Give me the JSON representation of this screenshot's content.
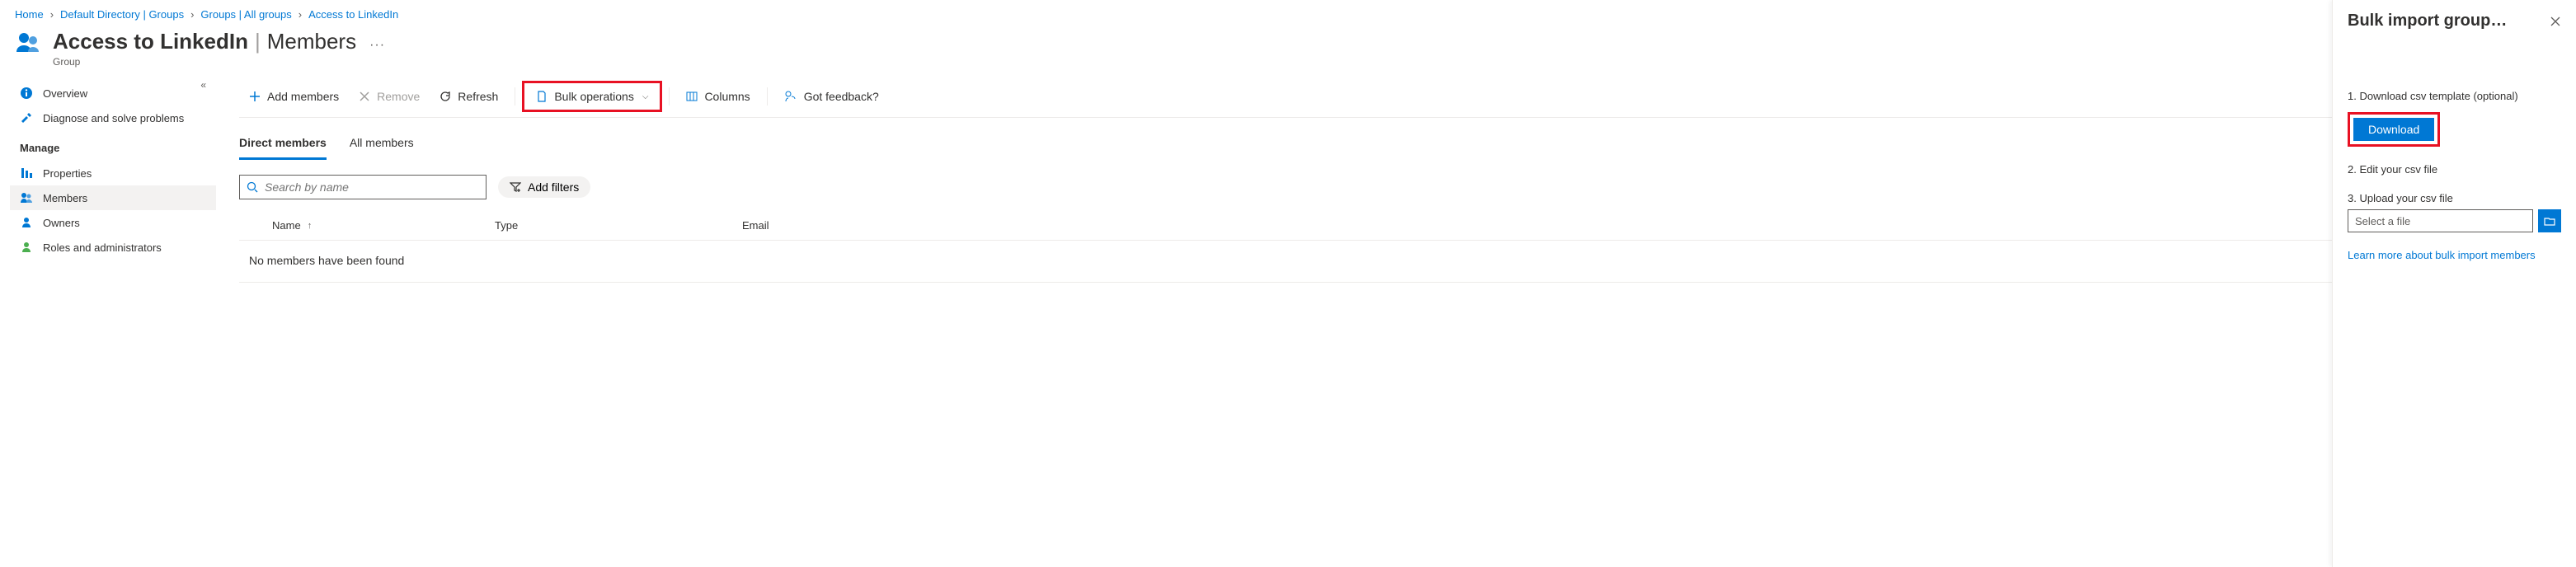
{
  "breadcrumb": {
    "items": [
      {
        "label": "Home"
      },
      {
        "label": "Default Directory | Groups"
      },
      {
        "label": "Groups | All groups"
      },
      {
        "label": "Access to LinkedIn"
      }
    ]
  },
  "header": {
    "title": "Access to LinkedIn",
    "separator": "|",
    "subtitle": "Members",
    "subtext": "Group"
  },
  "sidebar": {
    "overview": "Overview",
    "diagnose": "Diagnose and solve problems",
    "section_manage": "Manage",
    "properties": "Properties",
    "members": "Members",
    "owners": "Owners",
    "roles": "Roles and administrators"
  },
  "toolbar": {
    "add_members": "Add members",
    "remove": "Remove",
    "refresh": "Refresh",
    "bulk_ops": "Bulk operations",
    "columns": "Columns",
    "feedback": "Got feedback?"
  },
  "tabs": {
    "direct": "Direct members",
    "all": "All members"
  },
  "search": {
    "placeholder": "Search by name",
    "add_filters": "Add filters"
  },
  "table": {
    "col_name": "Name",
    "col_type": "Type",
    "col_email": "Email",
    "empty": "No members have been found"
  },
  "panel": {
    "title": "Bulk import group…",
    "step1": "1. Download csv template (optional)",
    "download": "Download",
    "step2": "2. Edit your csv file",
    "step3": "3. Upload your csv file",
    "file_placeholder": "Select a file",
    "learn": "Learn more about bulk import members"
  }
}
